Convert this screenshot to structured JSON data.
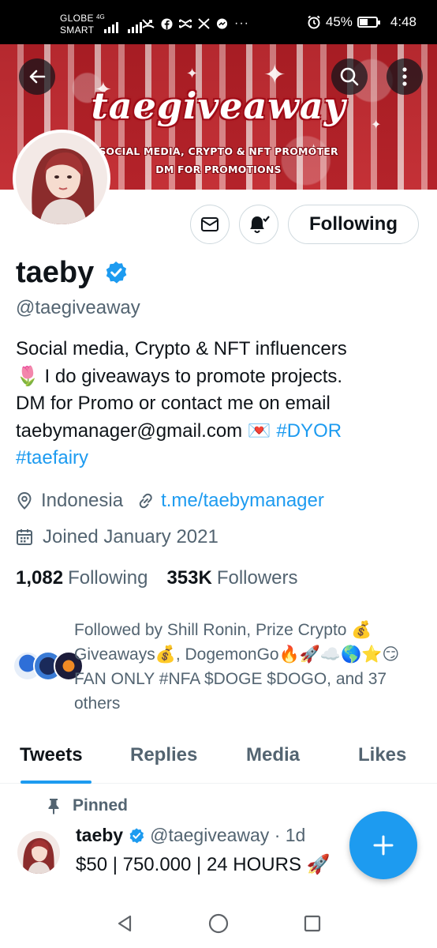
{
  "status_bar": {
    "carrier_line1": "GLOBE",
    "carrier_line2": "SMART",
    "network": "4G",
    "battery": "45%",
    "battery_level": 0.45,
    "time": "4:48",
    "notification_icons": [
      "call-missed-icon",
      "facebook-icon",
      "capcut-icon",
      "x-icon",
      "messenger-icon",
      "more-icon"
    ]
  },
  "banner": {
    "title": "taegiveaway",
    "line1": "SOCIAL MEDIA, CRYPTO & NFT PROMOTER",
    "line2": "DM FOR PROMOTIONS",
    "colors": {
      "primary": "#c23136",
      "accent": "#ffffff"
    }
  },
  "actions": {
    "following_label": "Following",
    "icons": [
      "envelope-icon",
      "bell-check-icon"
    ]
  },
  "profile": {
    "name": "taeby",
    "verified": true,
    "handle": "@taegiveaway",
    "bio_line1": "Social media, Crypto & NFT influencers",
    "bio_line2_emoji": "🌷",
    "bio_line2": " I do giveaways to promote projects.",
    "bio_line3": "DM for Promo or contact me on email",
    "bio_line4": "taebymanager@gmail.com",
    "bio_line4_emoji": " 💌 ",
    "bio_tag1": "#DYOR",
    "bio_tag2": "#taefairy",
    "location": "Indonesia",
    "link": "t.me/taebymanager",
    "joined": "Joined January 2021",
    "following_count": "1,082",
    "following_label": "Following",
    "followers_count": "353K",
    "followers_label": "Followers"
  },
  "followed_by": {
    "text": "Followed by Shill Ronin, Prize Crypto 💰 Giveaways💰, DogemonGo🔥🚀☁️🌎⭐😏 FAN ONLY #NFA $DOGE $DOGO, and 37 others"
  },
  "tabs": [
    "Tweets",
    "Replies",
    "Media",
    "Likes"
  ],
  "active_tab": "Tweets",
  "tweet": {
    "pinned_label": "Pinned",
    "name": "taeby",
    "handle_time": "@taegiveaway · 1d",
    "text": "$50 | 750.000 | 24 HOURS 🚀"
  },
  "theme": {
    "accent": "#1d9bf0",
    "text": "#0f1419",
    "secondary_text": "#536471",
    "border": "#cfd9de"
  }
}
